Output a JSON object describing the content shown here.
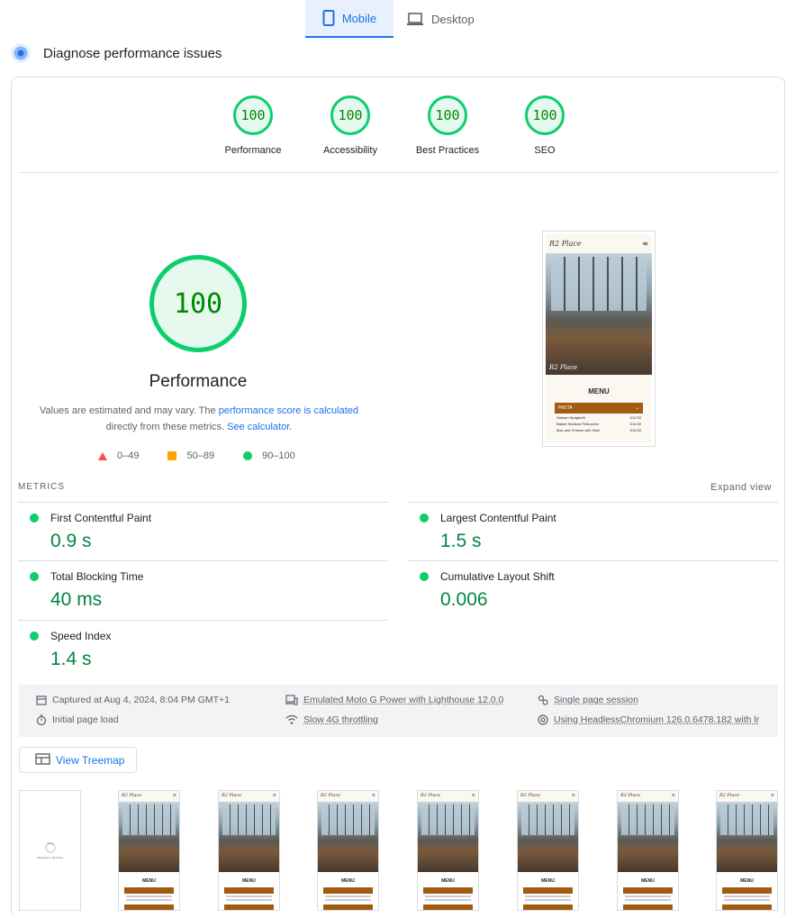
{
  "device_tabs": {
    "mobile": "Mobile",
    "desktop": "Desktop"
  },
  "diagnose_title": "Diagnose performance issues",
  "categories": [
    {
      "score": "100",
      "label": "Performance"
    },
    {
      "score": "100",
      "label": "Accessibility"
    },
    {
      "score": "100",
      "label": "Best Practices"
    },
    {
      "score": "100",
      "label": "SEO"
    }
  ],
  "main_gauge": {
    "score": "100",
    "label": "Performance",
    "desc_1": "Values are estimated and may vary. The ",
    "desc_link1": "performance score is calculated",
    "desc_2": " directly from these metrics. ",
    "desc_link2": "See calculator."
  },
  "legend": {
    "fail": "0–49",
    "average": "50–89",
    "pass": "90–100"
  },
  "screenshot": {
    "brand": "R2 Place",
    "menu_heading": "MENU",
    "section": "PASTA",
    "items": [
      {
        "name": "Salmon Spaghetti",
        "price": "£12.50"
      },
      {
        "name": "Baked Seafood Fettuccine",
        "price": "£14.50"
      },
      {
        "name": "Mac and Cheese with Ham",
        "price": "£10.50"
      }
    ]
  },
  "metrics_header": "METRICS",
  "expand_view": "Expand view",
  "metrics": [
    {
      "name": "First Contentful Paint",
      "value": "0.9 s"
    },
    {
      "name": "Largest Contentful Paint",
      "value": "1.5 s"
    },
    {
      "name": "Total Blocking Time",
      "value": "40 ms"
    },
    {
      "name": "Cumulative Layout Shift",
      "value": "0.006"
    },
    {
      "name": "Speed Index",
      "value": "1.4 s"
    }
  ],
  "runtime": {
    "captured": "Captured at Aug 4, 2024, 8:04 PM GMT+1",
    "emulated": "Emulated Moto G Power with Lighthouse 12.0.0",
    "session": "Single page session",
    "initial": "Initial page load",
    "throttling": "Slow 4G throttling",
    "browser": "Using HeadlessChromium 126.0.6478.182 with lr"
  },
  "treemap_label": "View Treemap",
  "filmstrip": {
    "loading_text": "Welcome to R2 Place",
    "frame_brand": "R2 Place",
    "frame_menu": "MENU"
  },
  "colors": {
    "pass": "#0cce6b",
    "pass_text": "#018642",
    "link": "#1a73e8",
    "average": "#ffa400",
    "fail": "#ff4e42"
  }
}
